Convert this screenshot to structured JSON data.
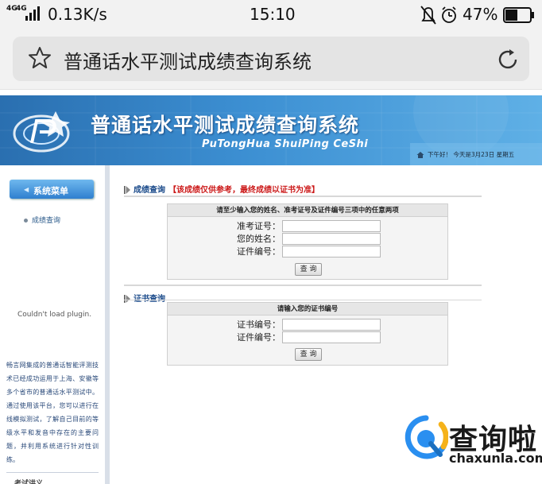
{
  "status_bar": {
    "network": "4G",
    "network2": "4G",
    "speed": "0.13K/s",
    "time": "15:10",
    "battery": "47%",
    "icons": [
      "mute-icon",
      "alarm-icon",
      "battery-icon"
    ]
  },
  "browser": {
    "page_title": "普通话水平测试成绩查询系统",
    "icons": [
      "star-icon",
      "reload-icon"
    ]
  },
  "banner": {
    "title": "普通话水平测试成绩查询系统",
    "subtitle": "PuTongHua ShuiPing CeShi",
    "greeting": "下午好！ 今天是3月23日 星期五"
  },
  "sidebar": {
    "menu_button": "系统菜单",
    "items": [
      {
        "label": "成绩查询"
      }
    ],
    "plugin_message": "Couldn't load plugin.",
    "description": "畅言网集成的普通话智能评测技术已经成功运用于上海、安徽等多个省市的普通话水平测试中。通过使用该平台，您可以进行在线模拟测试，了解自己目前的等级水平和发音中存在的主要问题，并利用系统进行针对性训练。",
    "footer": "考试讲义..."
  },
  "score_query": {
    "section_title": "成绩查询",
    "notice": "【该成绩仅供参考，最终成绩以证书为准】",
    "panel_header": "请至少输入您的姓名、准考证号及证件编号三项中的任意两项",
    "fields": [
      {
        "label": "准考证号：",
        "value": ""
      },
      {
        "label": "您的姓名：",
        "value": ""
      },
      {
        "label": "证件编号：",
        "value": ""
      }
    ],
    "button": "查 询"
  },
  "cert_query": {
    "section_title": "证书查询",
    "panel_header": "请输入您的证书编号",
    "fields": [
      {
        "label": "证书编号：",
        "value": ""
      },
      {
        "label": "证件编号：",
        "value": ""
      }
    ],
    "button": "查 询"
  },
  "watermark": {
    "text": "查询啦",
    "url": "chaxunla.com"
  },
  "colors": {
    "banner_blue": "#3c8fd2",
    "link_blue": "#1a4a8a",
    "notice_red": "#cc1a1a"
  }
}
